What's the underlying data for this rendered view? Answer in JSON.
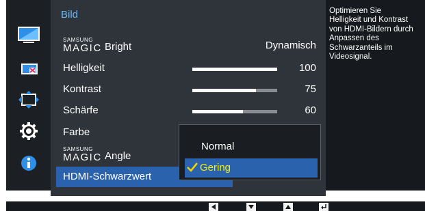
{
  "menu": {
    "title": "Bild",
    "rows": [
      {
        "label": "Bright",
        "brand_small": "SAMSUNG",
        "brand_big": "MAGIC",
        "value": "Dynamisch"
      },
      {
        "label": "Helligkeit",
        "value": "100",
        "level": 1.0
      },
      {
        "label": "Kontrast",
        "value": "75",
        "level": 0.75
      },
      {
        "label": "Schärfe",
        "value": "60",
        "level": 0.6
      },
      {
        "label": "Farbe"
      },
      {
        "label": "Angle",
        "brand_small": "SAMSUNG",
        "brand_big": "MAGIC"
      },
      {
        "label": "HDMI-Schwarzwert"
      }
    ]
  },
  "dropdown": {
    "options": [
      {
        "label": "Normal",
        "selected": false
      },
      {
        "label": "Gering",
        "selected": true
      }
    ]
  },
  "help": {
    "lines": [
      "Optimieren Sie",
      "Helligkeit und Kontrast",
      "von HDMI-Bildern durch",
      "Anpassen des",
      "Schwarzanteils im",
      "Videosignal."
    ]
  },
  "sidebar": {
    "icons": [
      "picture-icon",
      "onscreen-display-icon",
      "setup-arrows-icon",
      "settings-gear-icon",
      "information-icon"
    ]
  },
  "nav": {
    "buttons": [
      "left-arrow-icon",
      "down-arrow-icon",
      "up-arrow-icon",
      "enter-icon"
    ]
  },
  "colors": {
    "accent": "#2a62ad",
    "title": "#6fb9f2",
    "selected_option_text": "#f3f000",
    "check": "#f3d400"
  }
}
